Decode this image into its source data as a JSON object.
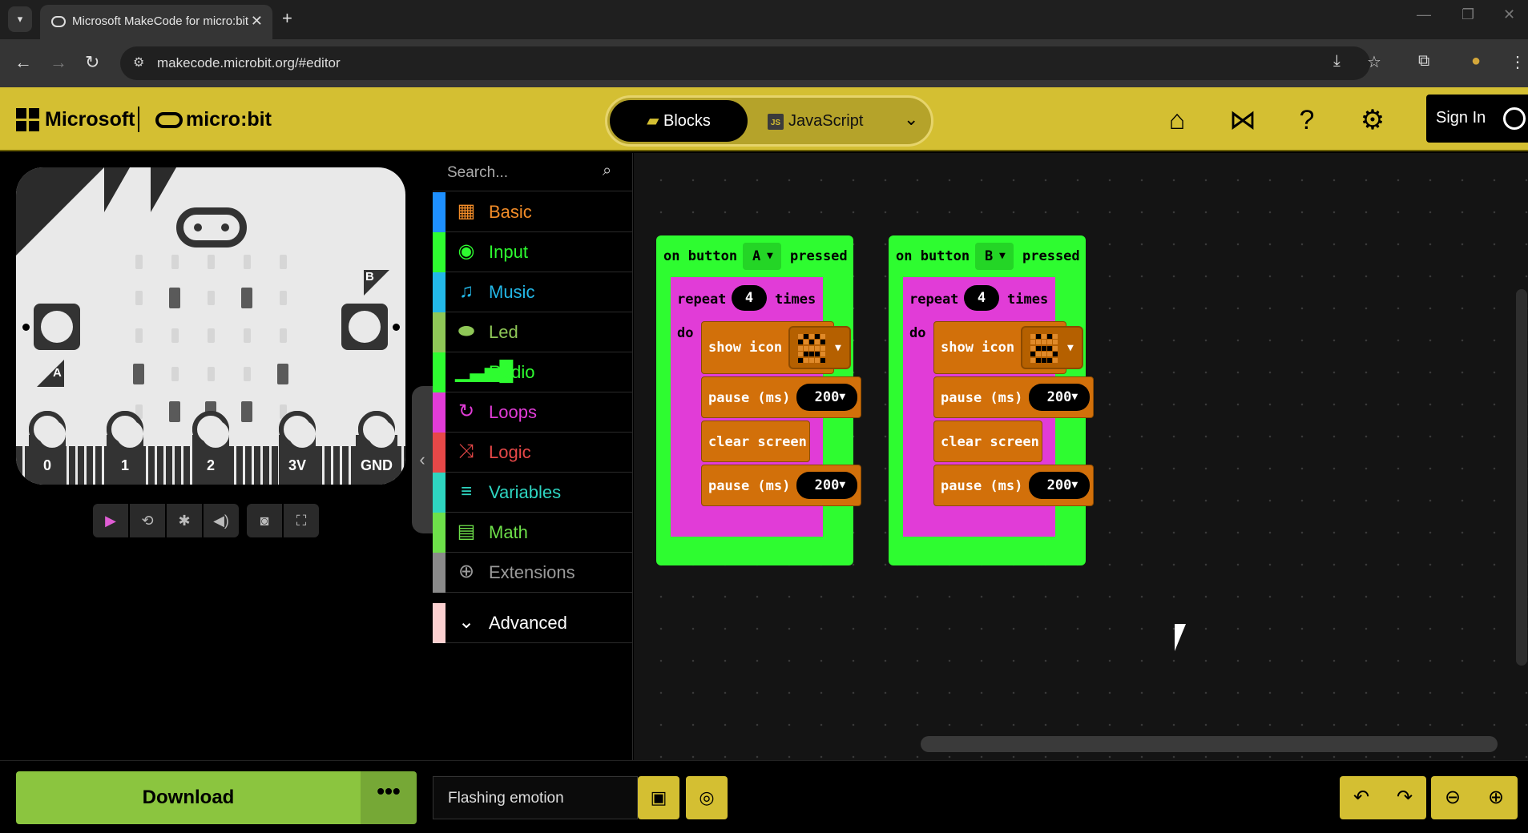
{
  "browser": {
    "tab_title": "Microsoft MakeCode for micro:bit",
    "url": "makecode.microbit.org/#editor"
  },
  "header": {
    "brand": "Microsoft",
    "product": "micro:bit",
    "mode_blocks": "Blocks",
    "mode_js": "JavaScript",
    "js_icon": "JS",
    "sign_in": "Sign In"
  },
  "simulator": {
    "label_a": "A",
    "label_b": "B",
    "pins": [
      "0",
      "1",
      "2",
      "3V",
      "GND"
    ]
  },
  "toolbox": {
    "search_placeholder": "Search...",
    "categories": [
      {
        "label": "Basic",
        "color": "#1e90ff",
        "text_color": "#f28c28"
      },
      {
        "label": "Input",
        "color": "#2efc30"
      },
      {
        "label": "Music",
        "color": "#23b8e8"
      },
      {
        "label": "Led",
        "color": "#8fc757"
      },
      {
        "label": "Radio",
        "color": "#2efc30"
      },
      {
        "label": "Loops",
        "color": "#e13cd7"
      },
      {
        "label": "Logic",
        "color": "#e64848"
      },
      {
        "label": "Variables",
        "color": "#2ed4c0"
      },
      {
        "label": "Math",
        "color": "#6ee04a"
      },
      {
        "label": "Extensions",
        "color": "#8a8a8a"
      }
    ],
    "advanced": "Advanced"
  },
  "workspace": {
    "blocks": [
      {
        "event_prefix": "on button",
        "button": "A",
        "event_suffix": "pressed",
        "repeat_label": "repeat",
        "repeat_count": "4",
        "times_label": "times",
        "do_label": "do",
        "show_icon": "show icon",
        "pause1_label": "pause (ms)",
        "pause1_value": "200",
        "clear_label": "clear screen",
        "pause2_label": "pause (ms)",
        "pause2_value": "200"
      },
      {
        "event_prefix": "on button",
        "button": "B",
        "event_suffix": "pressed",
        "repeat_label": "repeat",
        "repeat_count": "4",
        "times_label": "times",
        "do_label": "do",
        "show_icon": "show icon",
        "pause1_label": "pause (ms)",
        "pause1_value": "200",
        "clear_label": "clear screen",
        "pause2_label": "pause (ms)",
        "pause2_value": "200"
      }
    ]
  },
  "bottom": {
    "download": "Download",
    "more": "•••",
    "project_name": "Flashing emotion"
  }
}
